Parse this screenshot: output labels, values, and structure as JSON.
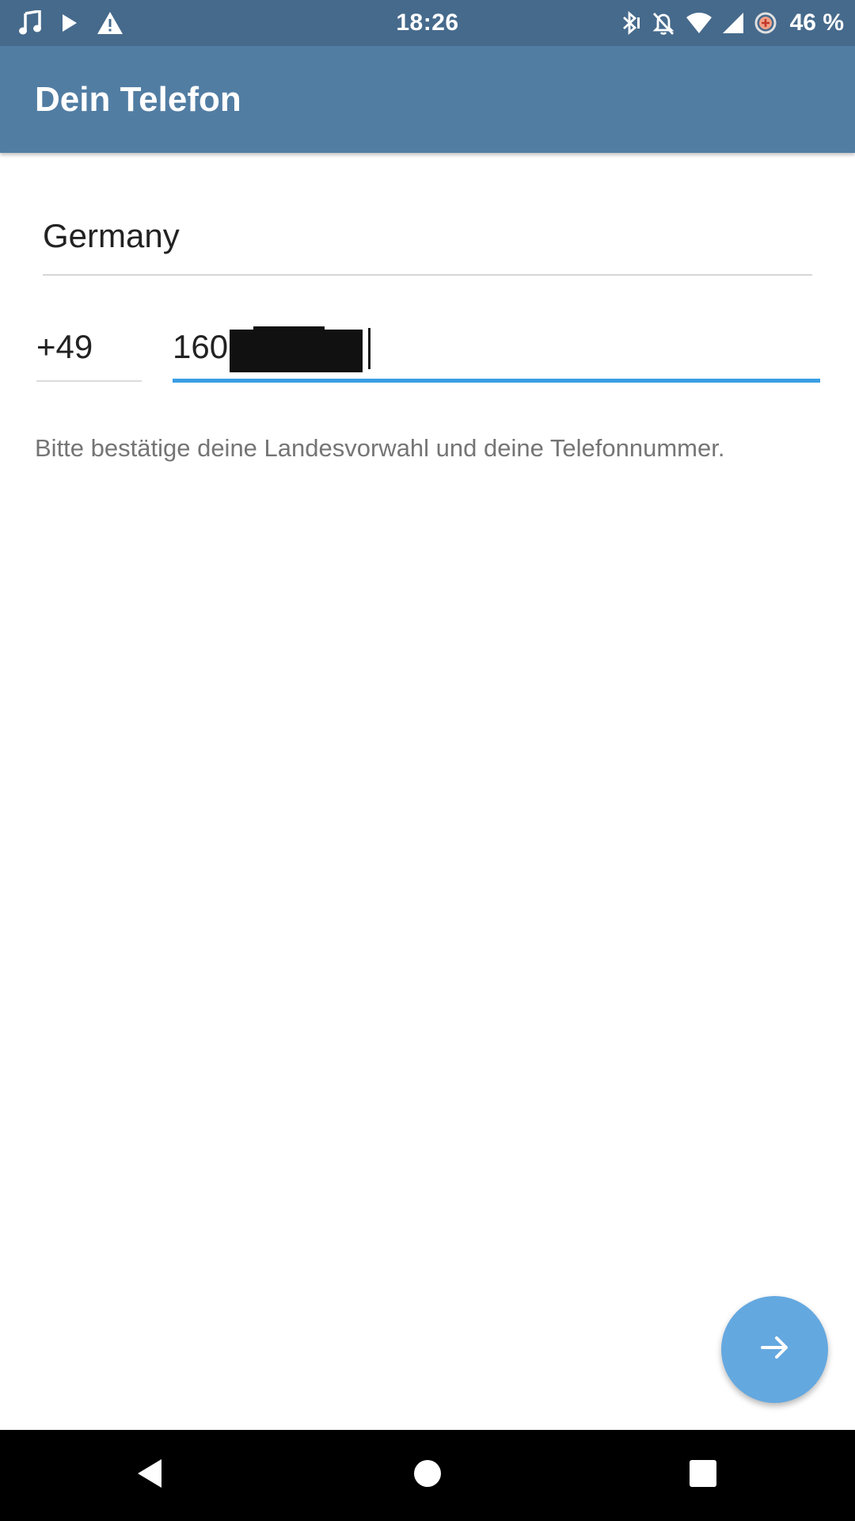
{
  "status_bar": {
    "time": "18:26",
    "battery": "46 %",
    "left_icons": [
      "music-note-icon",
      "play-icon",
      "warning-icon"
    ],
    "right_icons": [
      "bluetooth-icon",
      "notifications-off-icon",
      "wifi-icon",
      "signal-icon",
      "data-saver-icon"
    ]
  },
  "app_bar": {
    "title": "Dein Telefon"
  },
  "form": {
    "country": "Germany",
    "country_code": "+49",
    "phone_number": "160",
    "phone_number_redacted": true,
    "hint": "Bitte bestätige deine Landesvorwahl und deine Telefonnummer."
  },
  "fab": {
    "icon": "arrow-right-icon"
  },
  "nav_bar": {
    "buttons": [
      "back-icon",
      "home-icon",
      "recents-icon"
    ]
  },
  "colors": {
    "status_bar": "#466a8c",
    "app_bar": "#527da3",
    "accent_underline": "#3a9ee4",
    "fab": "#64a8e0",
    "hint_text": "#757575"
  }
}
